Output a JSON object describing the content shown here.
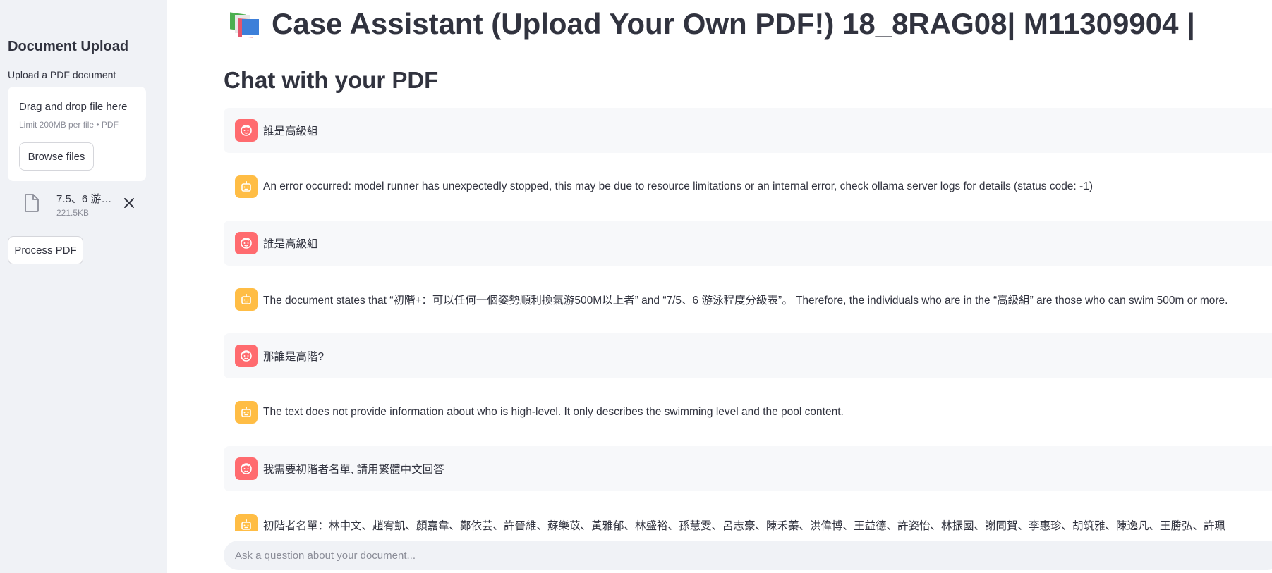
{
  "sidebar": {
    "title": "Document Upload",
    "upload_label": "Upload a PDF document",
    "dropzone": {
      "main_text": "Drag and drop file here",
      "sub_text": "Limit 200MB per file • PDF",
      "browse_label": "Browse files"
    },
    "file": {
      "name": "7.5、6 游…",
      "size": "221.5KB",
      "icon": "file-icon"
    },
    "process_label": "Process PDF"
  },
  "main": {
    "title_icon": "books-icon",
    "title": "Case Assistant (Upload Your Own PDF!) 18_8RAG08| M11309904 |",
    "subtitle": "Chat with your PDF",
    "messages": [
      {
        "role": "user",
        "text": "誰是高級組"
      },
      {
        "role": "assistant",
        "text": "An error occurred: model runner has unexpectedly stopped, this may be due to resource limitations or an internal error, check ollama server logs for details (status code: -1)"
      },
      {
        "role": "user",
        "text": "誰是高級組"
      },
      {
        "role": "assistant",
        "text": "The document states that “初階+：可以任何一個姿勢順利換氣游500M以上者” and “7/5、6 游泳程度分級表”。 Therefore, the individuals who are in the “高級組” are those who can swim 500m or more."
      },
      {
        "role": "user",
        "text": "那誰是高階?"
      },
      {
        "role": "assistant",
        "text": "The text does not provide information about who is high-level. It only describes the swimming level and the pool content."
      },
      {
        "role": "user",
        "text": "我需要初階者名單, 請用繁體中文回答"
      },
      {
        "role": "assistant",
        "text": "初階者名單：林中文、趙宥凱、顏嘉韋、鄭依芸、許晉維、蘇樂苡、黃雅郁、林盛裕、孫慧雯、呂志豪、陳禾蓁、洪偉博、王益德、許姿怡、林振國、謝同賀、李惠珍、胡筑雅、陳逸凡、王勝弘、許珮"
      }
    ],
    "chat_input": {
      "placeholder": "Ask a question about your document...",
      "send_icon": "send-icon"
    }
  },
  "colors": {
    "sidebar_bg": "#f0f2f6",
    "user_avatar": "#ff6b6f",
    "assistant_avatar": "#ffbd45",
    "user_msg_bg": "#f7f8fa",
    "text": "#31333f"
  }
}
